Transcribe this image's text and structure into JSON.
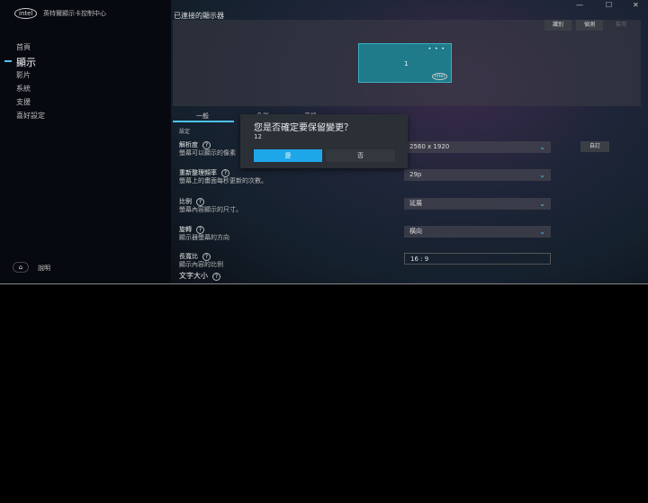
{
  "app": {
    "logo": "intel",
    "title": "英特爾顯示卡控制中心"
  },
  "sidebar": {
    "items": [
      {
        "label": "首頁"
      },
      {
        "label": "顯示"
      },
      {
        "label": "影片"
      },
      {
        "label": "系統"
      },
      {
        "label": "支援"
      },
      {
        "label": "喜好設定"
      }
    ],
    "active": "顯示",
    "help_label": "說明"
  },
  "window": {
    "minimize": "—",
    "maximize": "☐",
    "close": "✕"
  },
  "displays": {
    "title": "已連接的顯示器",
    "identify": "識別",
    "detect": "偵測",
    "apply": "套用",
    "monitor_number": "1",
    "monitor_dots": "• • •",
    "monitor_logo": "intel"
  },
  "tabs": [
    {
      "label": "一般"
    },
    {
      "label": "色彩"
    },
    {
      "label": "音訊"
    }
  ],
  "settings": {
    "section": "設定",
    "rows": [
      {
        "title": "解析度",
        "desc": "螢幕可以顯示的像素",
        "value": "2560 x 1920",
        "custom": "自訂"
      },
      {
        "title": "重新整理頻率",
        "desc": "螢幕上的畫面每秒更新的次數。",
        "value": "29p"
      },
      {
        "title": "比例",
        "desc": "螢幕內容顯示的尺寸。",
        "value": "延展"
      },
      {
        "title": "旋轉",
        "desc": "顯示器螢幕的方向",
        "value": "橫向"
      },
      {
        "title": "長寬比",
        "desc": "顯示內容的比例",
        "value": "16 : 9"
      },
      {
        "title": "文字大小",
        "desc": ""
      }
    ]
  },
  "dialog": {
    "title": "您是否確定要保留變更？",
    "countdown": "12",
    "yes": "是",
    "no": "否"
  },
  "colors": {
    "accent": "#1ea7e8"
  }
}
